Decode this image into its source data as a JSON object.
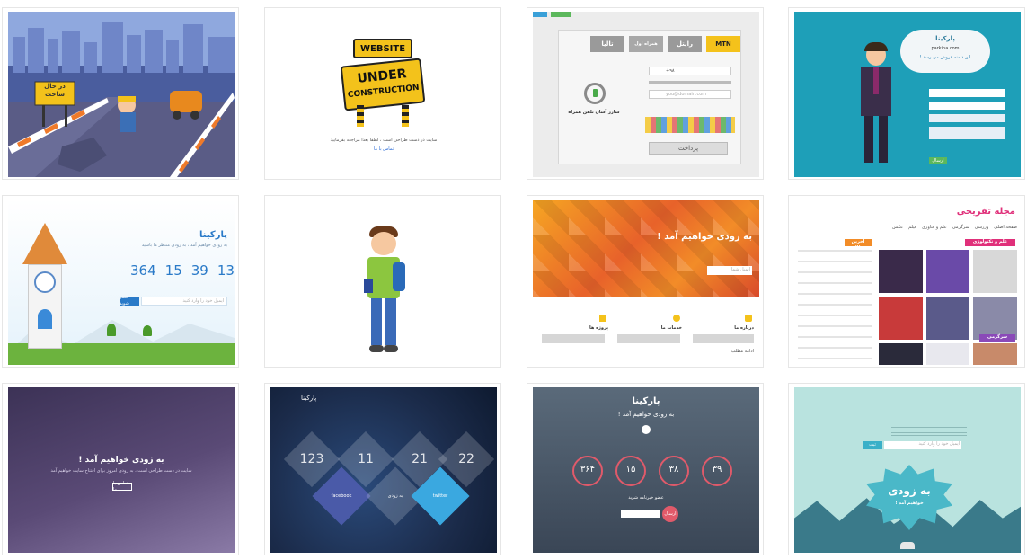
{
  "colors": {
    "road_blue": "#4a5d9e",
    "teal": "#1e9fb8",
    "orange": "#f28c28",
    "purple_dark": "#463a5e",
    "night_blue": "#1b2b4a",
    "mint": "#b9e3df"
  },
  "tiles": [
    {
      "id": "construction-road",
      "sign_line1": "در حال",
      "sign_line2": "ساخت"
    },
    {
      "id": "website-under-construction",
      "sign_top": "WEBSITE",
      "sign_main1": "UNDER",
      "sign_main2": "CONSTRUCTION",
      "caption": "سایت در دست طراحی است ، لطفا بعدا مراجعه بفرمایید",
      "link": "تماس با ما"
    },
    {
      "id": "payment-form",
      "tabs": [
        "MTN",
        "رایتل",
        "همراه اول",
        "تالیا"
      ],
      "country_code": "+۹۸",
      "email_placeholder": "you@domain.com",
      "heading": "شارژ آسان تلفن همراه",
      "pay_button": "پرداخت"
    },
    {
      "id": "businessman-signup",
      "title": "پارکینا",
      "domain": "parkina.com",
      "subtitle": "این دامنه فروش می رسد !",
      "submit": "ارسال"
    },
    {
      "id": "clock-tower-countdown",
      "title": "پارکینا",
      "subtitle": "به زودی خواهیم آمد ، به زودی منتظر ما باشید",
      "countdown": [
        "364",
        "15",
        "39",
        "13"
      ],
      "button": "عضو شوید",
      "input_placeholder": "ایمیل خود را وارد کنید"
    },
    {
      "id": "cartoon-boy"
    },
    {
      "id": "orange-lowpoly",
      "headline": "به زودی خواهیم آمد !",
      "input_placeholder": "ایمیل شما",
      "columns": [
        "درباره ما",
        "خدمات ما",
        "پروژه ها"
      ],
      "read_more": "ادامه مطلب"
    },
    {
      "id": "news-magazine",
      "title": "مجله تفریحی",
      "nav": [
        "صفحه اصلی",
        "ورزشی",
        "سرگرمی",
        "علم و فناوری",
        "فیلم",
        "عکس"
      ],
      "section1": "علم و تکنولوژی",
      "section2": "آخرین مطالب",
      "section3": "سرگرمی"
    },
    {
      "id": "purple-coming-soon",
      "headline": "به زودی خواهیم آمد !",
      "subtitle": "سایت در دست طراحی است ، به زودی امروز برای افتتاح سایت خواهیم آمد",
      "button": "تماس با ما"
    },
    {
      "id": "night-diamonds",
      "brand": "پارکینا",
      "numbers": [
        "123",
        "11",
        "21",
        "22"
      ],
      "facebook": "facebook",
      "middle": "به زودی",
      "twitter": "twitter"
    },
    {
      "id": "denim-circles",
      "title": "پارکینا",
      "subtitle": "به زودی خواهیم آمد !",
      "countdown": [
        "۳۹",
        "۳۸",
        "۱۵",
        "۳۶۴"
      ],
      "newsletter": "عضو خبرنامه شوید",
      "button": "ارسال"
    },
    {
      "id": "mint-mountains",
      "headline1": "به زودی",
      "headline2": "خواهیم آمد !",
      "input_placeholder": "ایمیل خود را وارد کنید",
      "button": "ثبت"
    }
  ]
}
